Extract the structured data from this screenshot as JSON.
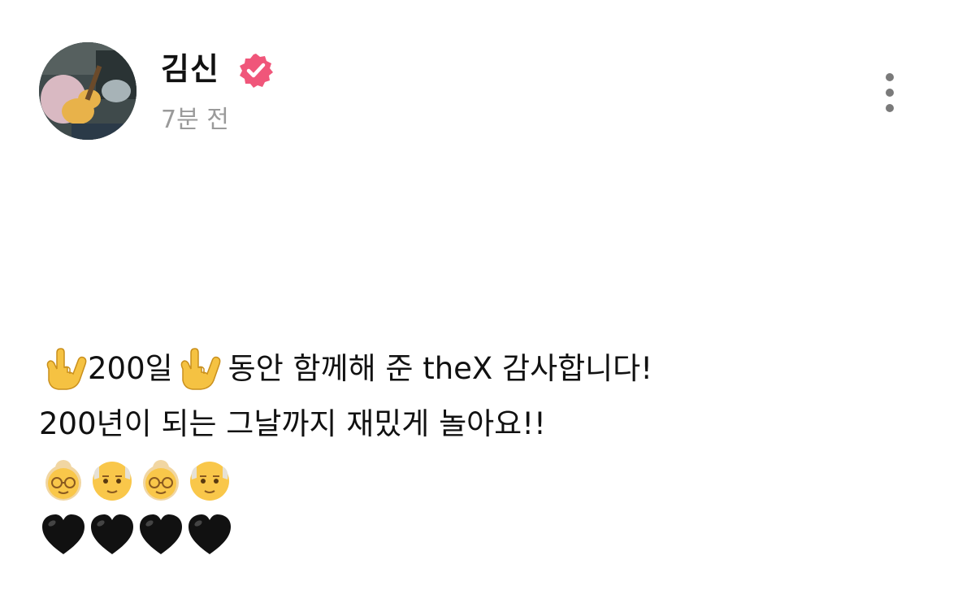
{
  "post": {
    "author": {
      "name": "김신",
      "verified": true,
      "avatar_icon": "avatar-guitar-photo"
    },
    "timestamp": "7분 전",
    "more_icon": "more-vertical-icon",
    "body": {
      "line1": {
        "emoji_left": "love-you-gesture-icon",
        "text_a": "200일",
        "emoji_mid": "love-you-gesture-icon",
        "text_b": "동안 함께해 준 theX 감사합니다!"
      },
      "line2": {
        "text": "200년이 되는 그날까지 재밌게 놀아요!!"
      },
      "line3": {
        "emojis": [
          "older-woman-icon",
          "older-man-icon",
          "older-woman-icon",
          "older-man-icon"
        ]
      },
      "line4": {
        "emojis": [
          "black-heart-icon",
          "black-heart-icon",
          "black-heart-icon",
          "black-heart-icon"
        ]
      }
    }
  },
  "colors": {
    "verified_badge": "#f0567a",
    "timestamp": "#9a9a9a",
    "more_dots": "#7a7a7a"
  }
}
